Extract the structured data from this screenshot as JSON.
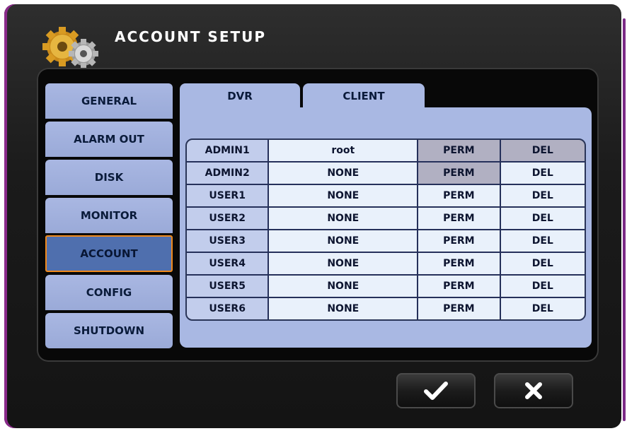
{
  "title": "ACCOUNT SETUP",
  "menu": [
    "GENERAL",
    "ALARM OUT",
    "DISK",
    "MONITOR",
    "ACCOUNT",
    "CONFIG",
    "SHUTDOWN"
  ],
  "active_menu": "ACCOUNT",
  "tabs": [
    "DVR",
    "CLIENT"
  ],
  "active_tab": "DVR",
  "rows": [
    {
      "user": "ADMIN1",
      "password": "root",
      "perm": "PERM",
      "del": "DEL"
    },
    {
      "user": "ADMIN2",
      "password": "NONE",
      "perm": "PERM",
      "del": "DEL"
    },
    {
      "user": "USER1",
      "password": "NONE",
      "perm": "PERM",
      "del": "DEL"
    },
    {
      "user": "USER2",
      "password": "NONE",
      "perm": "PERM",
      "del": "DEL"
    },
    {
      "user": "USER3",
      "password": "NONE",
      "perm": "PERM",
      "del": "DEL"
    },
    {
      "user": "USER4",
      "password": "NONE",
      "perm": "PERM",
      "del": "DEL"
    },
    {
      "user": "USER5",
      "password": "NONE",
      "perm": "PERM",
      "del": "DEL"
    },
    {
      "user": "USER6",
      "password": "NONE",
      "perm": "PERM",
      "del": "DEL"
    }
  ],
  "buttons": {
    "ok_icon": "check-icon",
    "cancel_icon": "close-icon"
  },
  "colors": {
    "accent": "#f08a1c",
    "active_menu": "#4f6fae",
    "panel": "#a9b8e3"
  }
}
